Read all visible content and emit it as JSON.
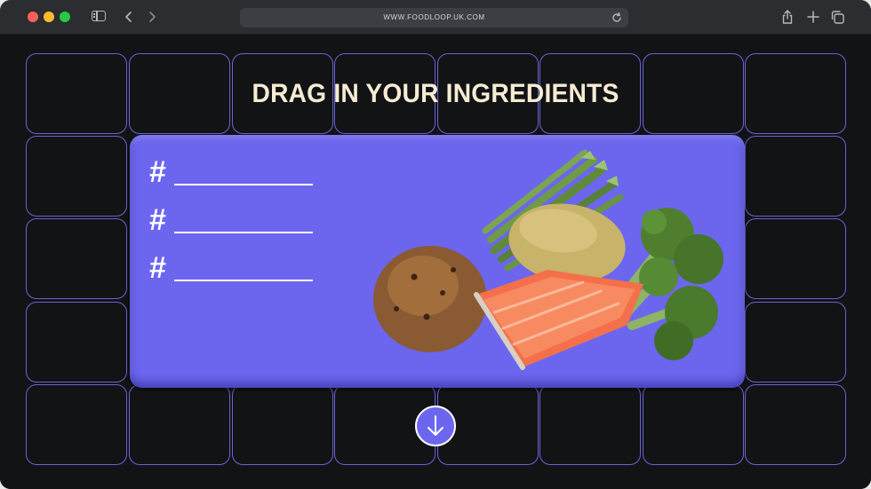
{
  "browser": {
    "url": "WWW.FOODLOOP.UK.COM"
  },
  "page": {
    "headline": "DRAG IN YOUR INGREDIENTS",
    "ingredient_slots": [
      {
        "marker": "#"
      },
      {
        "marker": "#"
      },
      {
        "marker": "#"
      }
    ],
    "ingredient_images": [
      "asparagus",
      "potato",
      "broccoli",
      "bread-roll",
      "salmon-fillet"
    ],
    "scroll_icon": "arrow-down-circle-icon"
  },
  "colors": {
    "background": "#111315",
    "grid_outline": "#6a63d6",
    "card": "#6c66ee",
    "headline": "#f7ecd3",
    "chrome": "#2c2d31"
  }
}
